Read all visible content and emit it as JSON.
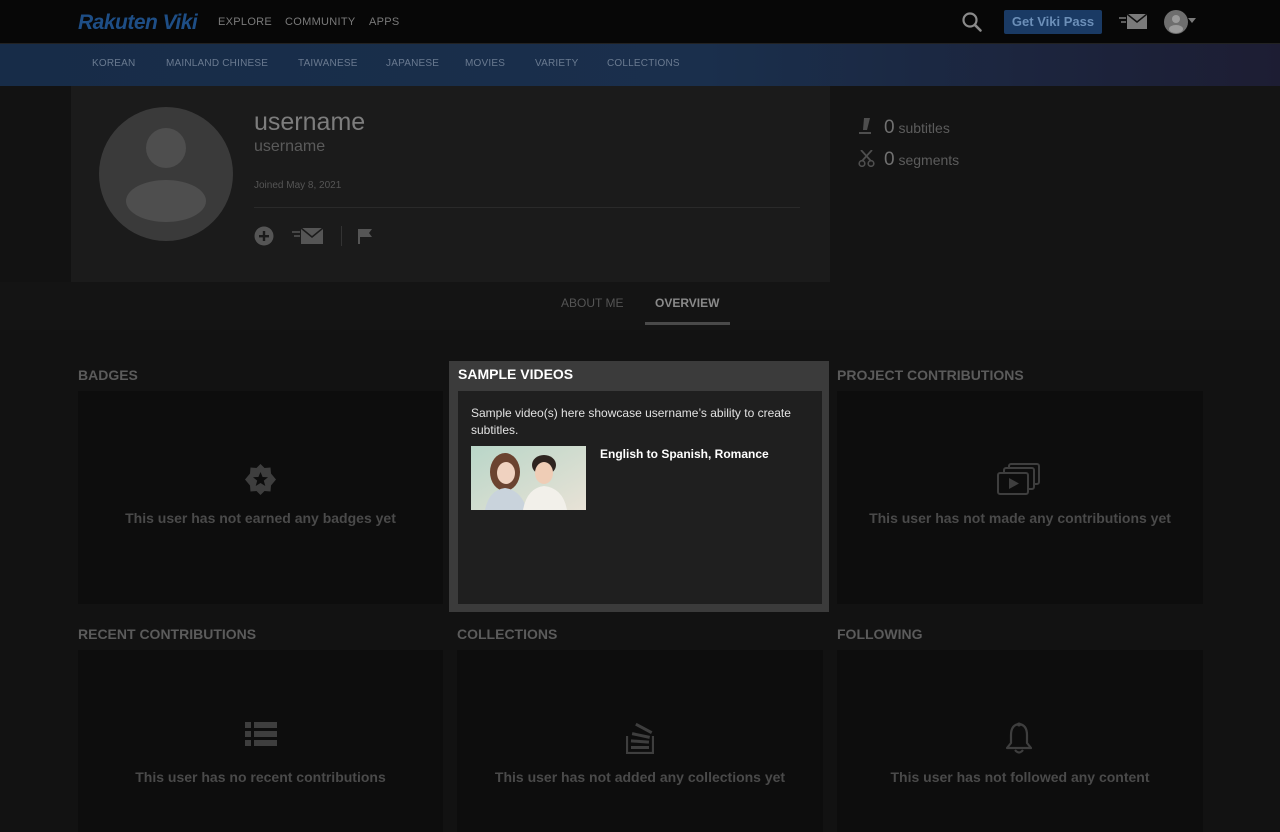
{
  "header": {
    "logo": "Rakuten Viki",
    "nav": [
      "EXPLORE",
      "COMMUNITY",
      "APPS"
    ],
    "vikipass_label": "Get Viki Pass"
  },
  "categories": [
    "KOREAN",
    "MAINLAND CHINESE",
    "TAIWANESE",
    "JAPANESE",
    "MOVIES",
    "VARIETY",
    "COLLECTIONS"
  ],
  "profile": {
    "name": "username",
    "handle": "username",
    "joined": "Joined May 8, 2021"
  },
  "stats": {
    "subtitles_count": "0",
    "subtitles_label": "subtitles",
    "segments_count": "0",
    "segments_label": "segments"
  },
  "tabs": {
    "about": "ABOUT ME",
    "overview": "OVERVIEW"
  },
  "sections": {
    "badges": {
      "title": "BADGES",
      "empty": "This user has not earned any badges yet"
    },
    "sample_videos": {
      "title": "SAMPLE VIDEOS",
      "description": "Sample video(s) here showcase username’s ability to create subtitles.",
      "video_label": "English to Spanish, Romance"
    },
    "project_contributions": {
      "title": "PROJECT CONTRIBUTIONS",
      "empty": "This user has not made any contributions yet"
    },
    "recent_contributions": {
      "title": "RECENT CONTRIBUTIONS",
      "empty": "This user has no recent contributions"
    },
    "collections": {
      "title": "COLLECTIONS",
      "empty": "This user has not added any collections yet"
    },
    "following": {
      "title": "FOLLOWING",
      "empty": "This user has not followed any content"
    }
  },
  "colors": {
    "brand": "#1e4e86",
    "highlight_panel": "#3b3b3b"
  },
  "icons": [
    "search-icon",
    "mail-icon",
    "avatar-icon",
    "add-friend-icon",
    "message-icon",
    "flag-icon",
    "pen-icon",
    "scissors-icon",
    "badge-star-icon",
    "video-stack-icon",
    "list-icon",
    "stack-icon",
    "bell-icon"
  ]
}
